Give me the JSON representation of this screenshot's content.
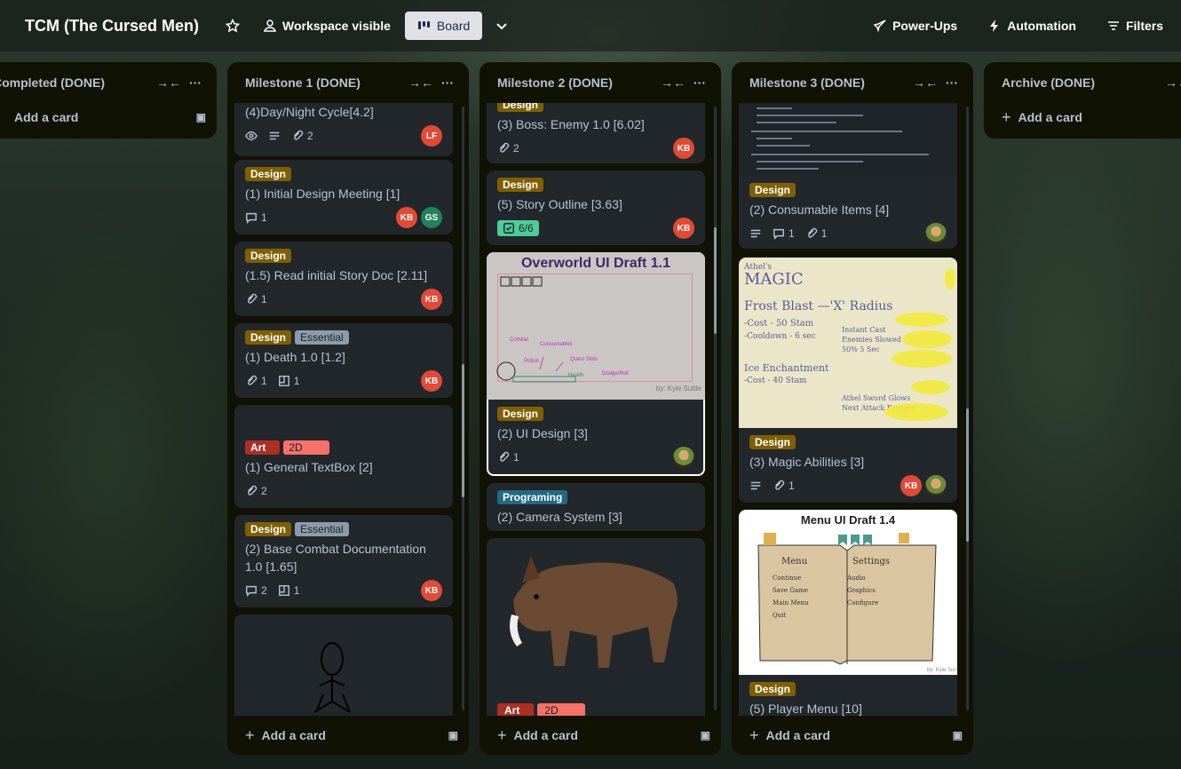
{
  "header": {
    "title": "TCM (The Cursed Men)",
    "visibility": "Workspace visible",
    "view": "Board",
    "powerups": "Power-Ups",
    "automation": "Automation",
    "filters": "Filters"
  },
  "lists": [
    {
      "title": "Completed (DONE)",
      "add": "Add a card"
    },
    {
      "title": "Milestone 1 (DONE)",
      "add": "Add a card",
      "cards": [
        {
          "title": "(4)Day/Night Cycle[4.2]",
          "attach": "2"
        },
        {
          "title": "(1) Initial Design Meeting [1]",
          "label": "Design",
          "comments": "1"
        },
        {
          "title": "(1.5) Read initial Story Doc [2.11]",
          "label": "Design",
          "attach": "1"
        },
        {
          "title": "(1) Death 1.0 [1.2]",
          "labels": [
            "Design",
            "Essential"
          ],
          "attach": "1",
          "boards": "1"
        },
        {
          "title": "(1) General TextBox [2]",
          "labels": [
            "Art",
            "2D"
          ],
          "attach": "2"
        },
        {
          "title": "(2) Base Combat Documentation 1.0 [1.65]",
          "labels": [
            "Design",
            "Essential"
          ],
          "comments": "2",
          "boards": "1"
        }
      ]
    },
    {
      "title": "Milestone 2 (DONE)",
      "add": "Add a card",
      "cards": [
        {
          "title": "(3) Boss: Enemy 1.0 [6.02]",
          "label": "Design",
          "attach": "2"
        },
        {
          "title": "(5) Story Outline [3.63]",
          "label": "Design",
          "checklist": "6/6"
        },
        {
          "title": "(2) UI Design [3]",
          "label": "Design",
          "attach": "1",
          "cover_title": "Overworld UI Draft 1.1",
          "cover_credit": "by: Kyle Suttle",
          "cover_notes": [
            "Combat",
            "Consumables",
            "Potion",
            "Dodge/Roll",
            "Health",
            "Quest Slots"
          ]
        },
        {
          "title": "(2) Camera System [3]",
          "label": "Programing"
        },
        {
          "labels": [
            "Art",
            "2D"
          ]
        }
      ]
    },
    {
      "title": "Milestone 3 (DONE)",
      "add": "Add a card",
      "cards": [
        {
          "title": "(2) Consumable Items [4]",
          "label": "Design",
          "comments": "1",
          "attach": "1"
        },
        {
          "title": "(3) Magic Abilities [3]",
          "label": "Design",
          "attach": "1",
          "cover_lines": [
            "Athel's",
            "MAGIC",
            "Frost Blast —'X' Radius",
            "-Cost - 50 Stam",
            "-Cooldown - 6 sec",
            "Instant Cast",
            "Enemies Slowed",
            "50% 5 Sec",
            "Ice Enchantment",
            "-Cost - 40 Stam",
            "Athel Sword Glows",
            "Next Attack Freezes"
          ]
        },
        {
          "title": "(5) Player Menu [10]",
          "label": "Design",
          "cover_title": "Menu UI Draft 1.4",
          "cover_credit": "by: Kyle Sut",
          "menu_left": [
            "Menu",
            "Continue",
            "Save Game",
            "Main Menu",
            "Quit"
          ],
          "menu_right": [
            "Settings",
            "Audio",
            "Graphics",
            "Configure"
          ]
        }
      ]
    },
    {
      "title": "Archive (DONE)",
      "add": "Add a card"
    }
  ],
  "members": {
    "kb": "KB",
    "lf": "LF",
    "gs": "GS"
  }
}
